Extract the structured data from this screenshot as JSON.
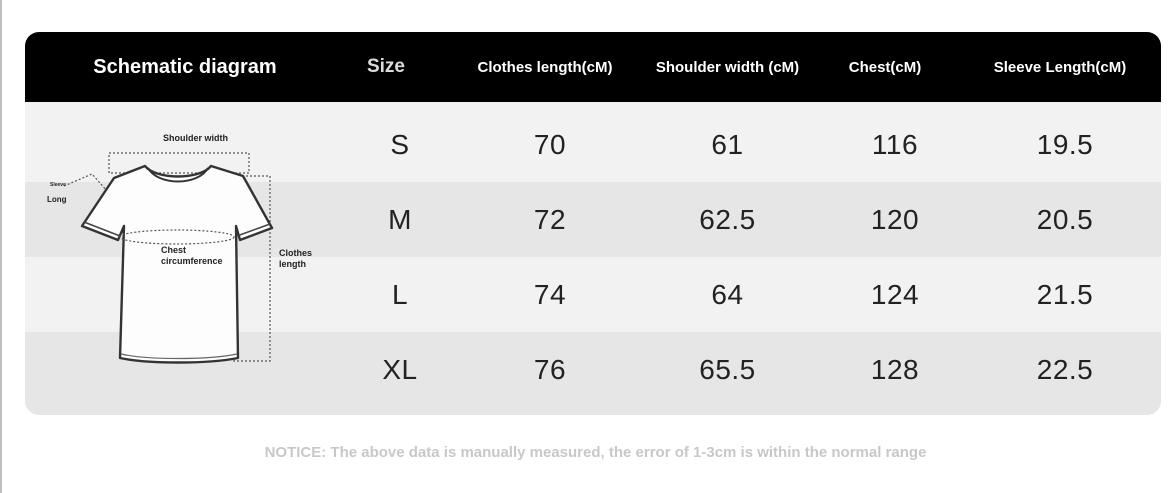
{
  "header": {
    "schematic": "Schematic diagram",
    "size": "Size",
    "clothes_length": "Clothes length(cM)",
    "shoulder_width": "Shoulder width (cM)",
    "chest": "Chest(cM)",
    "sleeve_length": "Sleeve Length(cM)"
  },
  "rows": [
    {
      "size": "S",
      "clothes_length": "70",
      "shoulder_width": "61",
      "chest": "116",
      "sleeve_length": "19.5"
    },
    {
      "size": "M",
      "clothes_length": "72",
      "shoulder_width": "62.5",
      "chest": "120",
      "sleeve_length": "20.5"
    },
    {
      "size": "L",
      "clothes_length": "74",
      "shoulder_width": "64",
      "chest": "124",
      "sleeve_length": "21.5"
    },
    {
      "size": "XL",
      "clothes_length": "76",
      "shoulder_width": "65.5",
      "chest": "128",
      "sleeve_length": "22.5"
    }
  ],
  "diagram": {
    "shoulder_width": "Shoulder width",
    "sleeve_tiny": "Sleeve",
    "sleeve_long": "Long",
    "chest_line1": "Chest",
    "chest_line2": "circumference",
    "clothes_line1": "Clothes",
    "clothes_line2": "length"
  },
  "notice": "NOTICE: The above data is manually measured, the error of 1-3cm is within the normal range",
  "colors": {
    "header_bg": "#000000",
    "row_light": "#f2f2f2",
    "row_dark": "#e6e6e6",
    "notice_text": "#c8c8c8"
  }
}
